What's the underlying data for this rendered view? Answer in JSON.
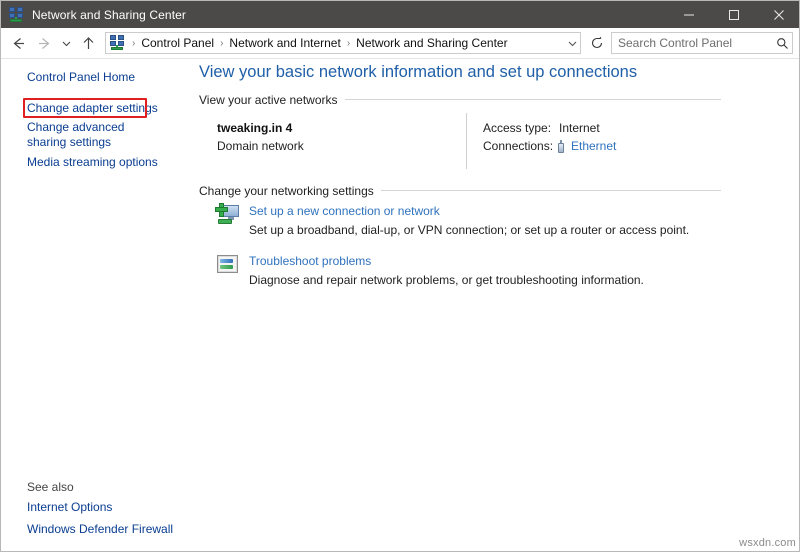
{
  "window": {
    "title": "Network and Sharing Center",
    "icon": "network-sharing-icon",
    "minimize_label": "–",
    "maximize_label": "□",
    "close_label": "✕"
  },
  "addressbar": {
    "back_label": "←",
    "forward_label": "→",
    "recent_label": "∨",
    "up_label": "↑",
    "refresh_label": "↻",
    "dropdown_label": "∨",
    "crumb_icon": "network-sharing-icon",
    "separator": "›",
    "breadcrumbs": [
      "Control Panel",
      "Network and Internet",
      "Network and Sharing Center"
    ]
  },
  "search": {
    "placeholder": "Search Control Panel",
    "value": "",
    "icon": "search-icon"
  },
  "sidebar": {
    "home_label": "Control Panel Home",
    "items": [
      {
        "label": "Change adapter settings",
        "highlighted": true
      },
      {
        "label": "Change advanced sharing settings",
        "highlighted": false
      },
      {
        "label": "Media streaming options",
        "highlighted": false
      }
    ],
    "see_also_label": "See also",
    "see_also_items": [
      {
        "label": "Internet Options"
      },
      {
        "label": "Windows Defender Firewall"
      }
    ]
  },
  "main": {
    "page_title": "View your basic network information and set up connections",
    "active_networks": {
      "section_label": "View your active networks",
      "network_name": "tweaking.in 4",
      "network_type": "Domain network",
      "access_type_label": "Access type:",
      "access_type_value": "Internet",
      "connections_label": "Connections:",
      "connection_name": "Ethernet",
      "connection_icon": "ethernet-connector-icon"
    },
    "networking_settings": {
      "section_label": "Change your networking settings",
      "tasks": [
        {
          "icon": "new-connection-icon",
          "link": "Set up a new connection or network",
          "description": "Set up a broadband, dial-up, or VPN connection; or set up a router or access point."
        },
        {
          "icon": "troubleshoot-icon",
          "link": "Troubleshoot problems",
          "description": "Diagnose and repair network problems, or get troubleshooting information."
        }
      ]
    }
  },
  "watermark": "wsxdn.com",
  "colors": {
    "titlebar": "#4c4a48",
    "link": "#2f72bd",
    "sidebar_link": "#0a3d91",
    "heading": "#1f5fa8",
    "highlight_box": "#e02020"
  }
}
